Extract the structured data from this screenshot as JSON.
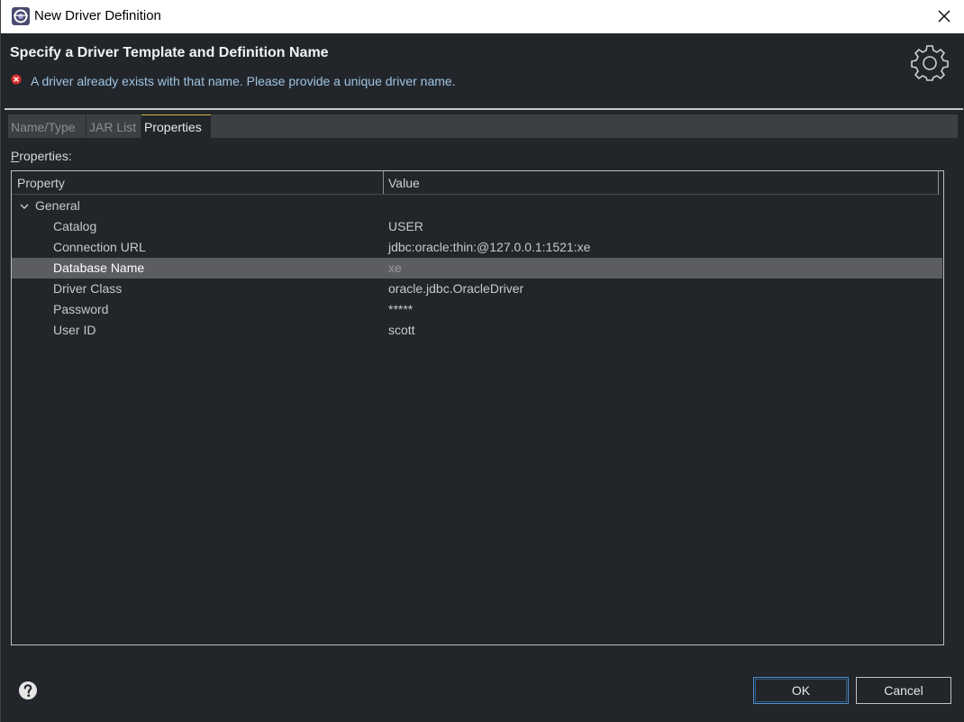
{
  "window": {
    "title": "New Driver Definition"
  },
  "header": {
    "title": "Specify a Driver Template and Definition Name",
    "error_message": "A driver already exists with that name. Please provide a unique driver name."
  },
  "tabs": [
    {
      "label": "Name/Type",
      "selected": false
    },
    {
      "label": "JAR List",
      "selected": false
    },
    {
      "label": "Properties",
      "selected": true
    }
  ],
  "properties": {
    "label_prefix": "P",
    "label_rest": "roperties:",
    "columns": [
      "Property",
      "Value"
    ],
    "group": "General",
    "rows": [
      {
        "name": "Catalog",
        "value": "USER"
      },
      {
        "name": "Connection URL",
        "value": "jdbc:oracle:thin:@127.0.0.1:1521:xe"
      },
      {
        "name": "Database Name",
        "value": "xe"
      },
      {
        "name": "Driver Class",
        "value": "oracle.jdbc.OracleDriver"
      },
      {
        "name": "Password",
        "value": "*****"
      },
      {
        "name": "User ID",
        "value": "scott"
      }
    ],
    "selected_row": "Database Name"
  },
  "footer": {
    "ok_label": "OK",
    "cancel_label": "Cancel"
  },
  "colors": {
    "background": "#22262b",
    "error_text": "#9fc4e2",
    "selected_row": "#5b5d60",
    "default_button_border": "#4e8fc9"
  }
}
